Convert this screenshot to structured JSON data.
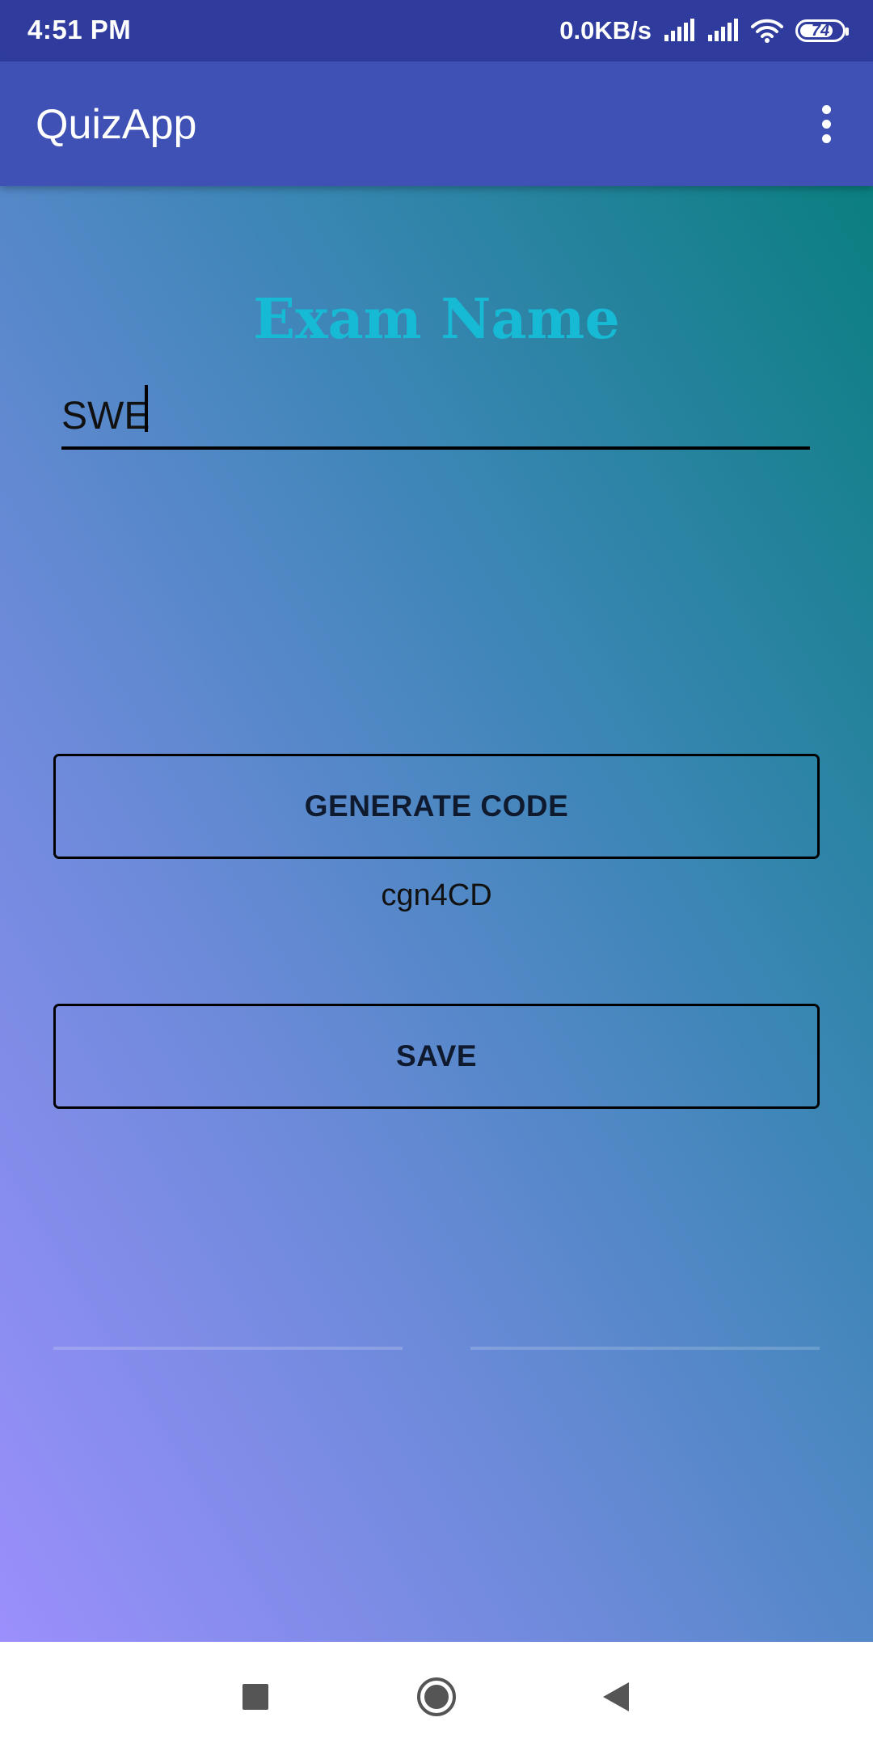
{
  "status_bar": {
    "time": "4:51 PM",
    "network_speed": "0.0KB/s",
    "battery_level": "74",
    "icons": [
      "signal-icon",
      "signal-icon",
      "wifi-icon",
      "battery-icon"
    ]
  },
  "app_bar": {
    "title": "QuizApp",
    "menu_icon": "more-vert-icon"
  },
  "form": {
    "heading": "Exam Name",
    "exam_name_value": "SWE",
    "generate_button_label": "GENERATE CODE",
    "generated_code": "cgn4CD",
    "save_button_label": "SAVE"
  },
  "nav_bar": {
    "icons": [
      "recents-icon",
      "home-icon",
      "back-icon"
    ]
  },
  "colors": {
    "status_bar": "#2f3c9e",
    "app_bar": "#3f51b5",
    "heading": "#17bad4",
    "gradient_top": "#0a7f80",
    "gradient_bottom": "#9b8ffc"
  }
}
